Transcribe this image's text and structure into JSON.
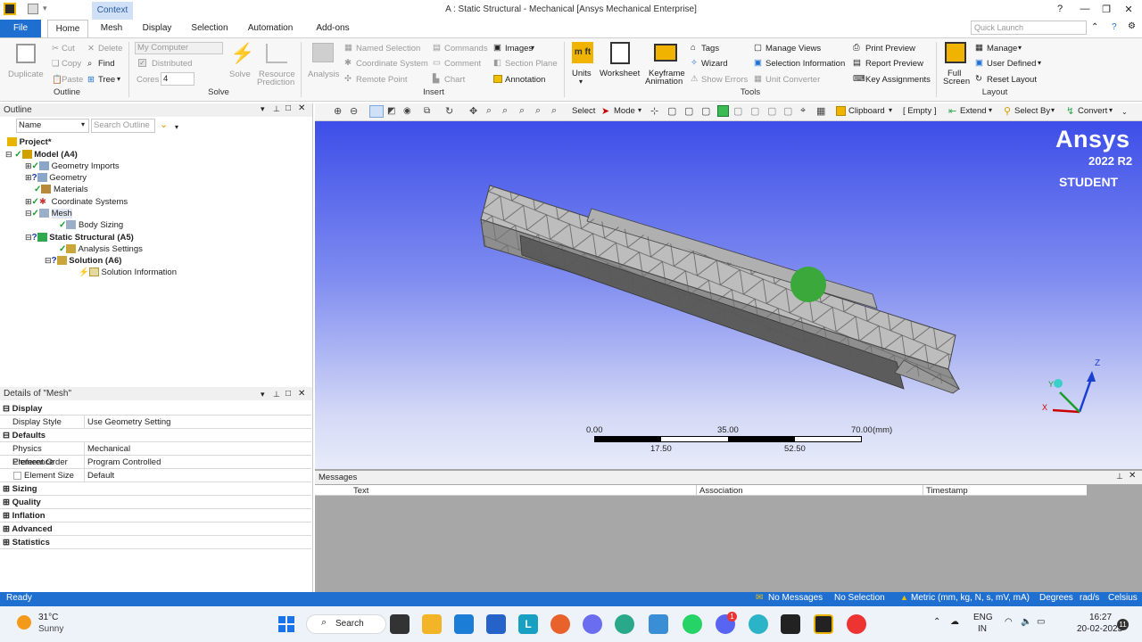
{
  "window": {
    "context_tab": "Context",
    "title": "A : Static Structural - Mechanical [Ansys Mechanical Enterprise]",
    "quick_launch": "Quick Launch"
  },
  "tabs": [
    "File",
    "Home",
    "Mesh",
    "Display",
    "Selection",
    "Automation",
    "Add-ons"
  ],
  "ribbon": {
    "outline": {
      "duplicate": "Duplicate",
      "cut": "Cut",
      "copy": "Copy",
      "paste": "Paste",
      "delete": "Delete",
      "find": "Find",
      "tree": "Tree",
      "label": "Outline"
    },
    "solve": {
      "computer": "My Computer",
      "distributed": "Distributed",
      "cores_label": "Cores",
      "cores_value": "4",
      "solve": "Solve",
      "resource": "Resource",
      "prediction": "Prediction",
      "label": "Solve"
    },
    "insert": {
      "analysis": "Analysis",
      "named_selection": "Named Selection",
      "coordinate_system": "Coordinate System",
      "remote_point": "Remote Point",
      "commands": "Commands",
      "comment": "Comment",
      "chart": "Chart",
      "images": "Images",
      "section_plane": "Section Plane",
      "annotation": "Annotation",
      "label": "Insert"
    },
    "tools": {
      "units": "Units",
      "worksheet": "Worksheet",
      "keyframe": "Keyframe",
      "animation": "Animation",
      "tags": "Tags",
      "wizard": "Wizard",
      "show_errors": "Show Errors",
      "manage_views": "Manage Views",
      "selection_info": "Selection Information",
      "unit_converter": "Unit Converter",
      "print_preview": "Print Preview",
      "report_preview": "Report Preview",
      "key_assignments": "Key Assignments",
      "label": "Tools"
    },
    "layout": {
      "full": "Full",
      "screen": "Screen",
      "manage": "Manage",
      "user_defined": "User Defined",
      "reset_layout": "Reset Layout",
      "label": "Layout"
    }
  },
  "outline": {
    "title": "Outline",
    "name_filter": "Name",
    "search_placeholder": "Search Outline",
    "tree": [
      {
        "label": "Project*",
        "bold": true
      },
      {
        "label": "Model (A4)",
        "bold": true
      },
      {
        "label": "Geometry Imports"
      },
      {
        "label": "Geometry"
      },
      {
        "label": "Materials"
      },
      {
        "label": "Coordinate Systems"
      },
      {
        "label": "Mesh"
      },
      {
        "label": "Body Sizing"
      },
      {
        "label": "Static Structural (A5)",
        "bold": true
      },
      {
        "label": "Analysis Settings"
      },
      {
        "label": "Solution (A6)",
        "bold": true
      },
      {
        "label": "Solution Information"
      }
    ]
  },
  "details": {
    "title": "Details of \"Mesh\"",
    "groups": {
      "display": "Display",
      "defaults": "Defaults",
      "sizing": "Sizing",
      "quality": "Quality",
      "inflation": "Inflation",
      "advanced": "Advanced",
      "statistics": "Statistics"
    },
    "rows": {
      "display_style": [
        "Display Style",
        "Use Geometry Setting"
      ],
      "physics": [
        "Physics Preference",
        "Mechanical"
      ],
      "element_order": [
        "Element Order",
        "Program Controlled"
      ],
      "element_size": [
        "Element Size",
        "Default"
      ]
    }
  },
  "graphics_toolbar": {
    "select": "Select",
    "mode": "Mode",
    "clipboard": "Clipboard",
    "empty": "[ Empty ]",
    "extend": "Extend",
    "select_by": "Select By",
    "convert": "Convert"
  },
  "viewport": {
    "brand": "Ansys",
    "version": "2022 R2",
    "edition": "STUDENT",
    "scale": {
      "ticks_top": [
        "0.00",
        "35.00",
        "70.00"
      ],
      "ticks_bottom": [
        "17.50",
        "52.50"
      ],
      "unit": "(mm)"
    },
    "triad": {
      "x": "X",
      "y": "Y",
      "z": "Z"
    }
  },
  "messages": {
    "title": "Messages",
    "columns": [
      "Text",
      "Association",
      "Timestamp"
    ]
  },
  "status": {
    "ready": "Ready",
    "messages": "No Messages",
    "selection": "No Selection",
    "units": "Metric (mm, kg, N, s, mV, mA)",
    "angle": "Degrees",
    "rate": "rad/s",
    "temp": "Celsius"
  },
  "taskbar": {
    "temp": "31°C",
    "weather": "Sunny",
    "search": "Search",
    "lang1": "ENG",
    "lang2": "IN",
    "time": "16:27",
    "date": "20-02-2023",
    "notif": "11",
    "badge": "1"
  },
  "colors": {
    "accent": "#1f6fd1",
    "viewport_top": "#3d4ee8",
    "viewport_bottom": "#e8ebfa",
    "probe": "#3aa83a"
  }
}
